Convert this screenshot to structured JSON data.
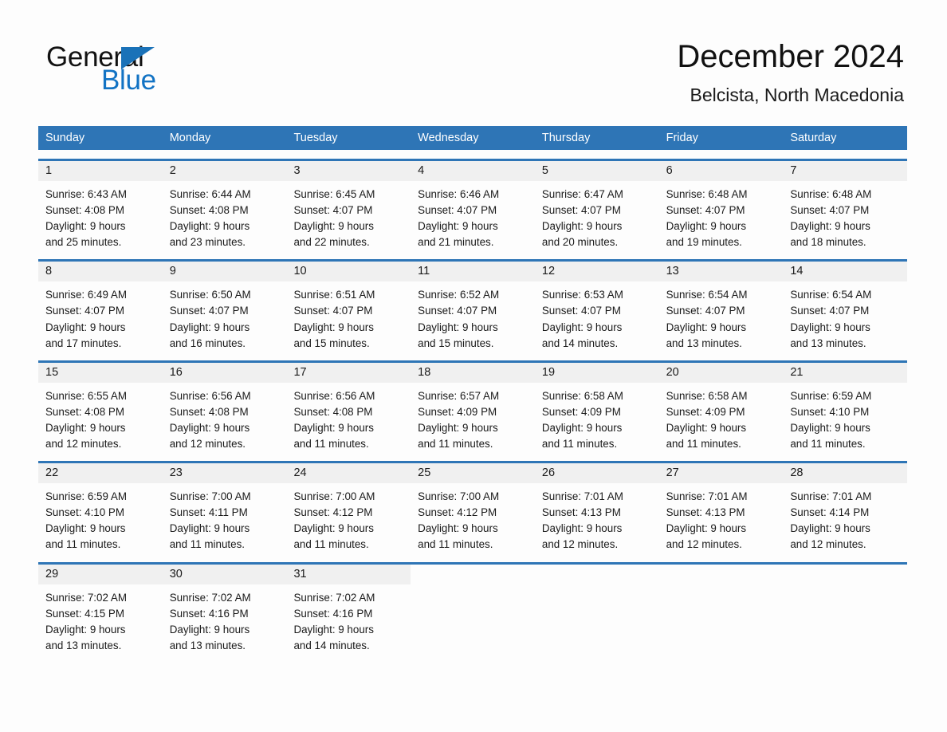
{
  "brand": {
    "word_one": "General",
    "word_two": "Blue",
    "triangle_icon": "triangle-icon",
    "accent_color": "#1a72b8"
  },
  "header": {
    "title": "December 2024",
    "subtitle": "Belcista, North Macedonia"
  },
  "colors": {
    "header_blue": "#2e75b6",
    "date_band_gray": "#f0f0f0",
    "page_background": "#fdfdfd",
    "text": "#1a1a1a"
  },
  "weekdays": [
    "Sunday",
    "Monday",
    "Tuesday",
    "Wednesday",
    "Thursday",
    "Friday",
    "Saturday"
  ],
  "weeks": [
    [
      {
        "day": "1",
        "sunrise": "Sunrise: 6:43 AM",
        "sunset": "Sunset: 4:08 PM",
        "daylight_1": "Daylight: 9 hours",
        "daylight_2": "and 25 minutes."
      },
      {
        "day": "2",
        "sunrise": "Sunrise: 6:44 AM",
        "sunset": "Sunset: 4:08 PM",
        "daylight_1": "Daylight: 9 hours",
        "daylight_2": "and 23 minutes."
      },
      {
        "day": "3",
        "sunrise": "Sunrise: 6:45 AM",
        "sunset": "Sunset: 4:07 PM",
        "daylight_1": "Daylight: 9 hours",
        "daylight_2": "and 22 minutes."
      },
      {
        "day": "4",
        "sunrise": "Sunrise: 6:46 AM",
        "sunset": "Sunset: 4:07 PM",
        "daylight_1": "Daylight: 9 hours",
        "daylight_2": "and 21 minutes."
      },
      {
        "day": "5",
        "sunrise": "Sunrise: 6:47 AM",
        "sunset": "Sunset: 4:07 PM",
        "daylight_1": "Daylight: 9 hours",
        "daylight_2": "and 20 minutes."
      },
      {
        "day": "6",
        "sunrise": "Sunrise: 6:48 AM",
        "sunset": "Sunset: 4:07 PM",
        "daylight_1": "Daylight: 9 hours",
        "daylight_2": "and 19 minutes."
      },
      {
        "day": "7",
        "sunrise": "Sunrise: 6:48 AM",
        "sunset": "Sunset: 4:07 PM",
        "daylight_1": "Daylight: 9 hours",
        "daylight_2": "and 18 minutes."
      }
    ],
    [
      {
        "day": "8",
        "sunrise": "Sunrise: 6:49 AM",
        "sunset": "Sunset: 4:07 PM",
        "daylight_1": "Daylight: 9 hours",
        "daylight_2": "and 17 minutes."
      },
      {
        "day": "9",
        "sunrise": "Sunrise: 6:50 AM",
        "sunset": "Sunset: 4:07 PM",
        "daylight_1": "Daylight: 9 hours",
        "daylight_2": "and 16 minutes."
      },
      {
        "day": "10",
        "sunrise": "Sunrise: 6:51 AM",
        "sunset": "Sunset: 4:07 PM",
        "daylight_1": "Daylight: 9 hours",
        "daylight_2": "and 15 minutes."
      },
      {
        "day": "11",
        "sunrise": "Sunrise: 6:52 AM",
        "sunset": "Sunset: 4:07 PM",
        "daylight_1": "Daylight: 9 hours",
        "daylight_2": "and 15 minutes."
      },
      {
        "day": "12",
        "sunrise": "Sunrise: 6:53 AM",
        "sunset": "Sunset: 4:07 PM",
        "daylight_1": "Daylight: 9 hours",
        "daylight_2": "and 14 minutes."
      },
      {
        "day": "13",
        "sunrise": "Sunrise: 6:54 AM",
        "sunset": "Sunset: 4:07 PM",
        "daylight_1": "Daylight: 9 hours",
        "daylight_2": "and 13 minutes."
      },
      {
        "day": "14",
        "sunrise": "Sunrise: 6:54 AM",
        "sunset": "Sunset: 4:07 PM",
        "daylight_1": "Daylight: 9 hours",
        "daylight_2": "and 13 minutes."
      }
    ],
    [
      {
        "day": "15",
        "sunrise": "Sunrise: 6:55 AM",
        "sunset": "Sunset: 4:08 PM",
        "daylight_1": "Daylight: 9 hours",
        "daylight_2": "and 12 minutes."
      },
      {
        "day": "16",
        "sunrise": "Sunrise: 6:56 AM",
        "sunset": "Sunset: 4:08 PM",
        "daylight_1": "Daylight: 9 hours",
        "daylight_2": "and 12 minutes."
      },
      {
        "day": "17",
        "sunrise": "Sunrise: 6:56 AM",
        "sunset": "Sunset: 4:08 PM",
        "daylight_1": "Daylight: 9 hours",
        "daylight_2": "and 11 minutes."
      },
      {
        "day": "18",
        "sunrise": "Sunrise: 6:57 AM",
        "sunset": "Sunset: 4:09 PM",
        "daylight_1": "Daylight: 9 hours",
        "daylight_2": "and 11 minutes."
      },
      {
        "day": "19",
        "sunrise": "Sunrise: 6:58 AM",
        "sunset": "Sunset: 4:09 PM",
        "daylight_1": "Daylight: 9 hours",
        "daylight_2": "and 11 minutes."
      },
      {
        "day": "20",
        "sunrise": "Sunrise: 6:58 AM",
        "sunset": "Sunset: 4:09 PM",
        "daylight_1": "Daylight: 9 hours",
        "daylight_2": "and 11 minutes."
      },
      {
        "day": "21",
        "sunrise": "Sunrise: 6:59 AM",
        "sunset": "Sunset: 4:10 PM",
        "daylight_1": "Daylight: 9 hours",
        "daylight_2": "and 11 minutes."
      }
    ],
    [
      {
        "day": "22",
        "sunrise": "Sunrise: 6:59 AM",
        "sunset": "Sunset: 4:10 PM",
        "daylight_1": "Daylight: 9 hours",
        "daylight_2": "and 11 minutes."
      },
      {
        "day": "23",
        "sunrise": "Sunrise: 7:00 AM",
        "sunset": "Sunset: 4:11 PM",
        "daylight_1": "Daylight: 9 hours",
        "daylight_2": "and 11 minutes."
      },
      {
        "day": "24",
        "sunrise": "Sunrise: 7:00 AM",
        "sunset": "Sunset: 4:12 PM",
        "daylight_1": "Daylight: 9 hours",
        "daylight_2": "and 11 minutes."
      },
      {
        "day": "25",
        "sunrise": "Sunrise: 7:00 AM",
        "sunset": "Sunset: 4:12 PM",
        "daylight_1": "Daylight: 9 hours",
        "daylight_2": "and 11 minutes."
      },
      {
        "day": "26",
        "sunrise": "Sunrise: 7:01 AM",
        "sunset": "Sunset: 4:13 PM",
        "daylight_1": "Daylight: 9 hours",
        "daylight_2": "and 12 minutes."
      },
      {
        "day": "27",
        "sunrise": "Sunrise: 7:01 AM",
        "sunset": "Sunset: 4:13 PM",
        "daylight_1": "Daylight: 9 hours",
        "daylight_2": "and 12 minutes."
      },
      {
        "day": "28",
        "sunrise": "Sunrise: 7:01 AM",
        "sunset": "Sunset: 4:14 PM",
        "daylight_1": "Daylight: 9 hours",
        "daylight_2": "and 12 minutes."
      }
    ],
    [
      {
        "day": "29",
        "sunrise": "Sunrise: 7:02 AM",
        "sunset": "Sunset: 4:15 PM",
        "daylight_1": "Daylight: 9 hours",
        "daylight_2": "and 13 minutes."
      },
      {
        "day": "30",
        "sunrise": "Sunrise: 7:02 AM",
        "sunset": "Sunset: 4:16 PM",
        "daylight_1": "Daylight: 9 hours",
        "daylight_2": "and 13 minutes."
      },
      {
        "day": "31",
        "sunrise": "Sunrise: 7:02 AM",
        "sunset": "Sunset: 4:16 PM",
        "daylight_1": "Daylight: 9 hours",
        "daylight_2": "and 14 minutes."
      },
      {
        "day": "",
        "sunrise": "",
        "sunset": "",
        "daylight_1": "",
        "daylight_2": ""
      },
      {
        "day": "",
        "sunrise": "",
        "sunset": "",
        "daylight_1": "",
        "daylight_2": ""
      },
      {
        "day": "",
        "sunrise": "",
        "sunset": "",
        "daylight_1": "",
        "daylight_2": ""
      },
      {
        "day": "",
        "sunrise": "",
        "sunset": "",
        "daylight_1": "",
        "daylight_2": ""
      }
    ]
  ]
}
